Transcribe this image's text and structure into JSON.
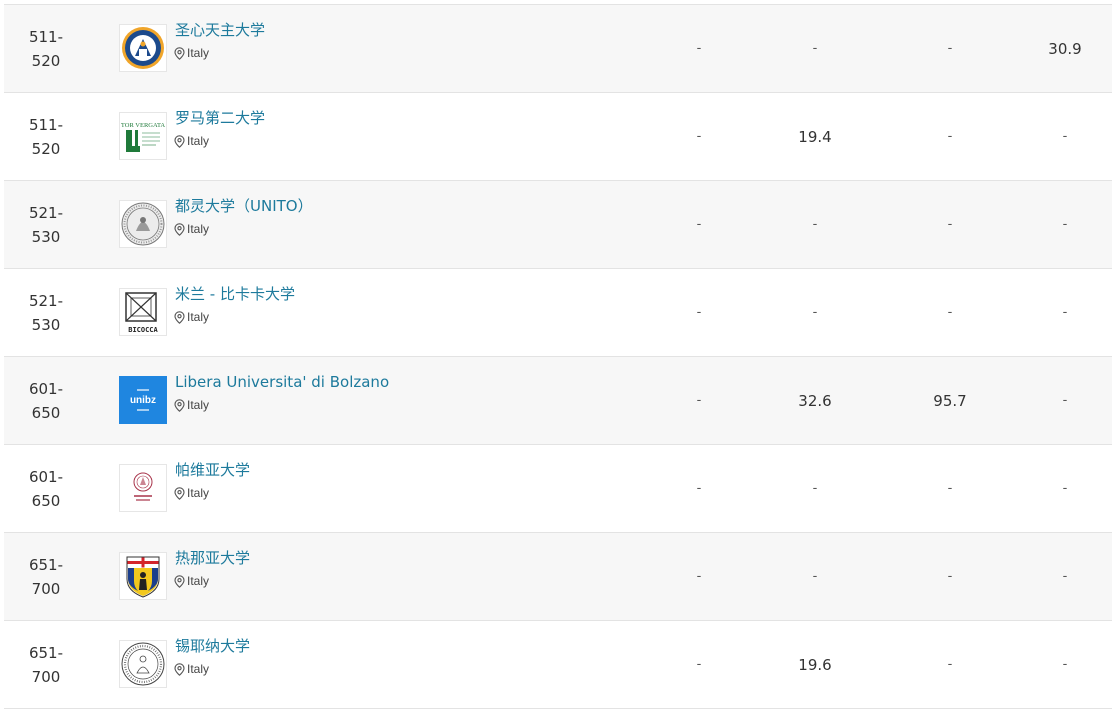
{
  "rows": [
    {
      "rank_top": "511-",
      "rank_bottom": "520",
      "name": "圣心天主大学",
      "location": "Italy",
      "logo_icon": "sacred-heart-seal-icon",
      "values": [
        "-",
        "-",
        "-",
        "30.9"
      ]
    },
    {
      "rank_top": "511-",
      "rank_bottom": "520",
      "name": "罗马第二大学",
      "location": "Italy",
      "logo_icon": "tor-vergata-logo-icon",
      "logo_text": "TOR VERGATA",
      "values": [
        "-",
        "19.4",
        "-",
        "-"
      ]
    },
    {
      "rank_top": "521-",
      "rank_bottom": "530",
      "name": "都灵大学（UNITO）",
      "location": "Italy",
      "logo_icon": "turin-seal-icon",
      "values": [
        "-",
        "-",
        "-",
        "-"
      ]
    },
    {
      "rank_top": "521-",
      "rank_bottom": "530",
      "name": "米兰 - 比卡卡大学",
      "location": "Italy",
      "logo_icon": "bicocca-logo-icon",
      "logo_text": "BICOCCA",
      "values": [
        "-",
        "-",
        "-",
        "-"
      ]
    },
    {
      "rank_top": "601-",
      "rank_bottom": "650",
      "name": "Libera Universita' di Bolzano",
      "location": "Italy",
      "logo_icon": "unibz-logo-icon",
      "logo_text": "unibz",
      "values": [
        "-",
        "32.6",
        "95.7",
        "-"
      ]
    },
    {
      "rank_top": "601-",
      "rank_bottom": "650",
      "name": "帕维亚大学",
      "location": "Italy",
      "logo_icon": "pavia-seal-icon",
      "values": [
        "-",
        "-",
        "-",
        "-"
      ]
    },
    {
      "rank_top": "651-",
      "rank_bottom": "700",
      "name": "热那亚大学",
      "location": "Italy",
      "logo_icon": "genoa-shield-icon",
      "values": [
        "-",
        "-",
        "-",
        "-"
      ]
    },
    {
      "rank_top": "651-",
      "rank_bottom": "700",
      "name": "锡耶纳大学",
      "location": "Italy",
      "logo_icon": "siena-seal-icon",
      "values": [
        "-",
        "19.6",
        "-",
        "-"
      ]
    }
  ],
  "colors": {
    "link": "#1d7a9c",
    "row_alt": "#f7f7f7",
    "border": "#e3e3e3",
    "unibz_blue": "#1f86e0",
    "genoa_red": "#d4252b",
    "genoa_yellow": "#f2c81e",
    "tor_vergata_green": "#1f7a3a"
  }
}
